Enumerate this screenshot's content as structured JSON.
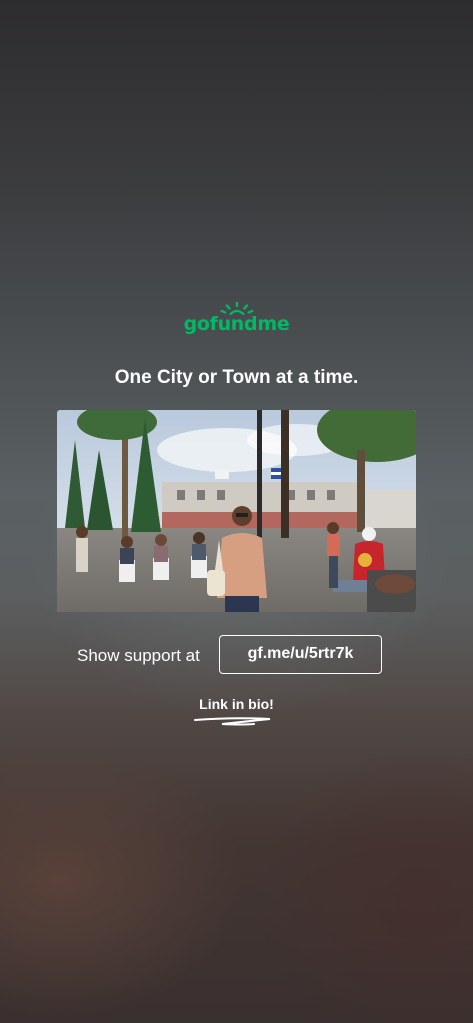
{
  "story": {
    "brand": {
      "wordmark": "gofundme",
      "icon": "sun-rays-icon",
      "color": "#00b964"
    },
    "headline": "One City or Town at a time.",
    "photo": {
      "description_icon": "event-photo"
    },
    "support": {
      "label": "Show support at",
      "link": "gf.me/u/5rtr7k"
    },
    "bio_prompt": "Link in bio!"
  }
}
